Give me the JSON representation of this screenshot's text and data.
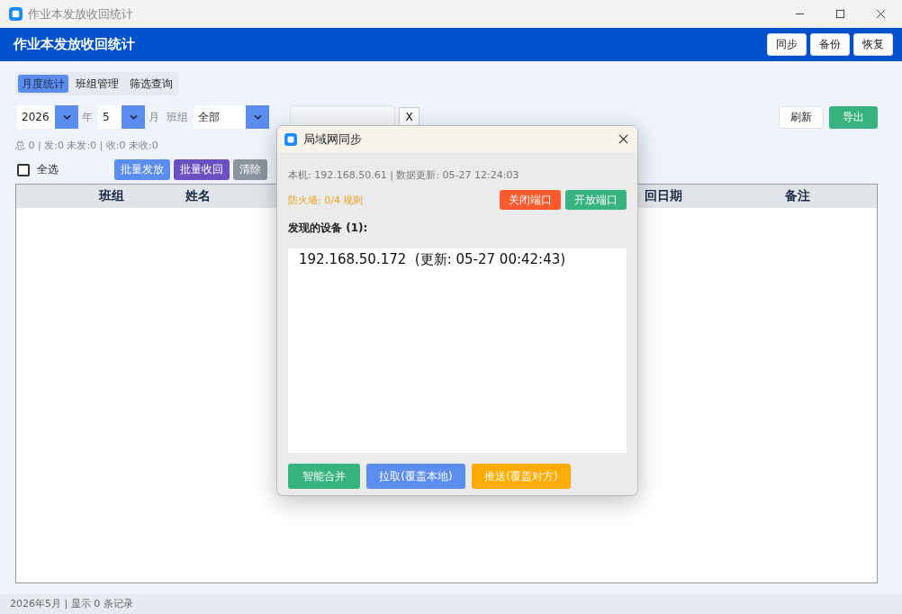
{
  "window": {
    "title": "作业本发放收回统计"
  },
  "header": {
    "title": "作业本发放收回统计",
    "buttons": [
      "同步",
      "备份",
      "恢复"
    ]
  },
  "tabs": [
    {
      "label": "月度统计",
      "selected": true
    },
    {
      "label": "班组管理",
      "selected": false
    },
    {
      "label": "筛选查询",
      "selected": false
    }
  ],
  "filters": {
    "year": "2026",
    "year_unit": "年",
    "month": "5",
    "month_unit": "月",
    "class_label": "班组",
    "class_value": "全部",
    "search_clear": "X"
  },
  "actions": [
    "刷新",
    "导出"
  ],
  "summary": "总 0 | 发:0 未发:0 | 收:0 未收:0",
  "select_all": {
    "label": "全选",
    "checked": false
  },
  "batch_buttons": [
    {
      "label": "批量发放",
      "color": "#5b8def"
    },
    {
      "label": "批量收回",
      "color": "#6c4fc1"
    },
    {
      "label": "清除",
      "color": "#8a939e"
    }
  ],
  "table": {
    "columns": [
      "班组",
      "姓名",
      "回日期",
      "备注"
    ]
  },
  "status_bar": "2026年5月 | 显示 0 条记录",
  "dialog": {
    "title": "局域网同步",
    "info": "本机: 192.168.50.61  |  数据更新: 05-27 12:24:03",
    "firewall": "防火墙: 0/4 规则",
    "port_buttons": [
      {
        "label": "关闭端口",
        "color": "#fb5a2e"
      },
      {
        "label": "开放端口",
        "color": "#36b37e"
      }
    ],
    "devices_label": "发现的设备 (1):",
    "devices": [
      "192.168.50.172  (更新: 05-27 00:42:43)"
    ],
    "buttons": [
      {
        "label": "智能合并",
        "color": "#36b37e"
      },
      {
        "label": "拉取(覆盖本地)",
        "color": "#5b8def"
      },
      {
        "label": "推送(覆盖对方)",
        "color": "#ffab00"
      }
    ]
  }
}
